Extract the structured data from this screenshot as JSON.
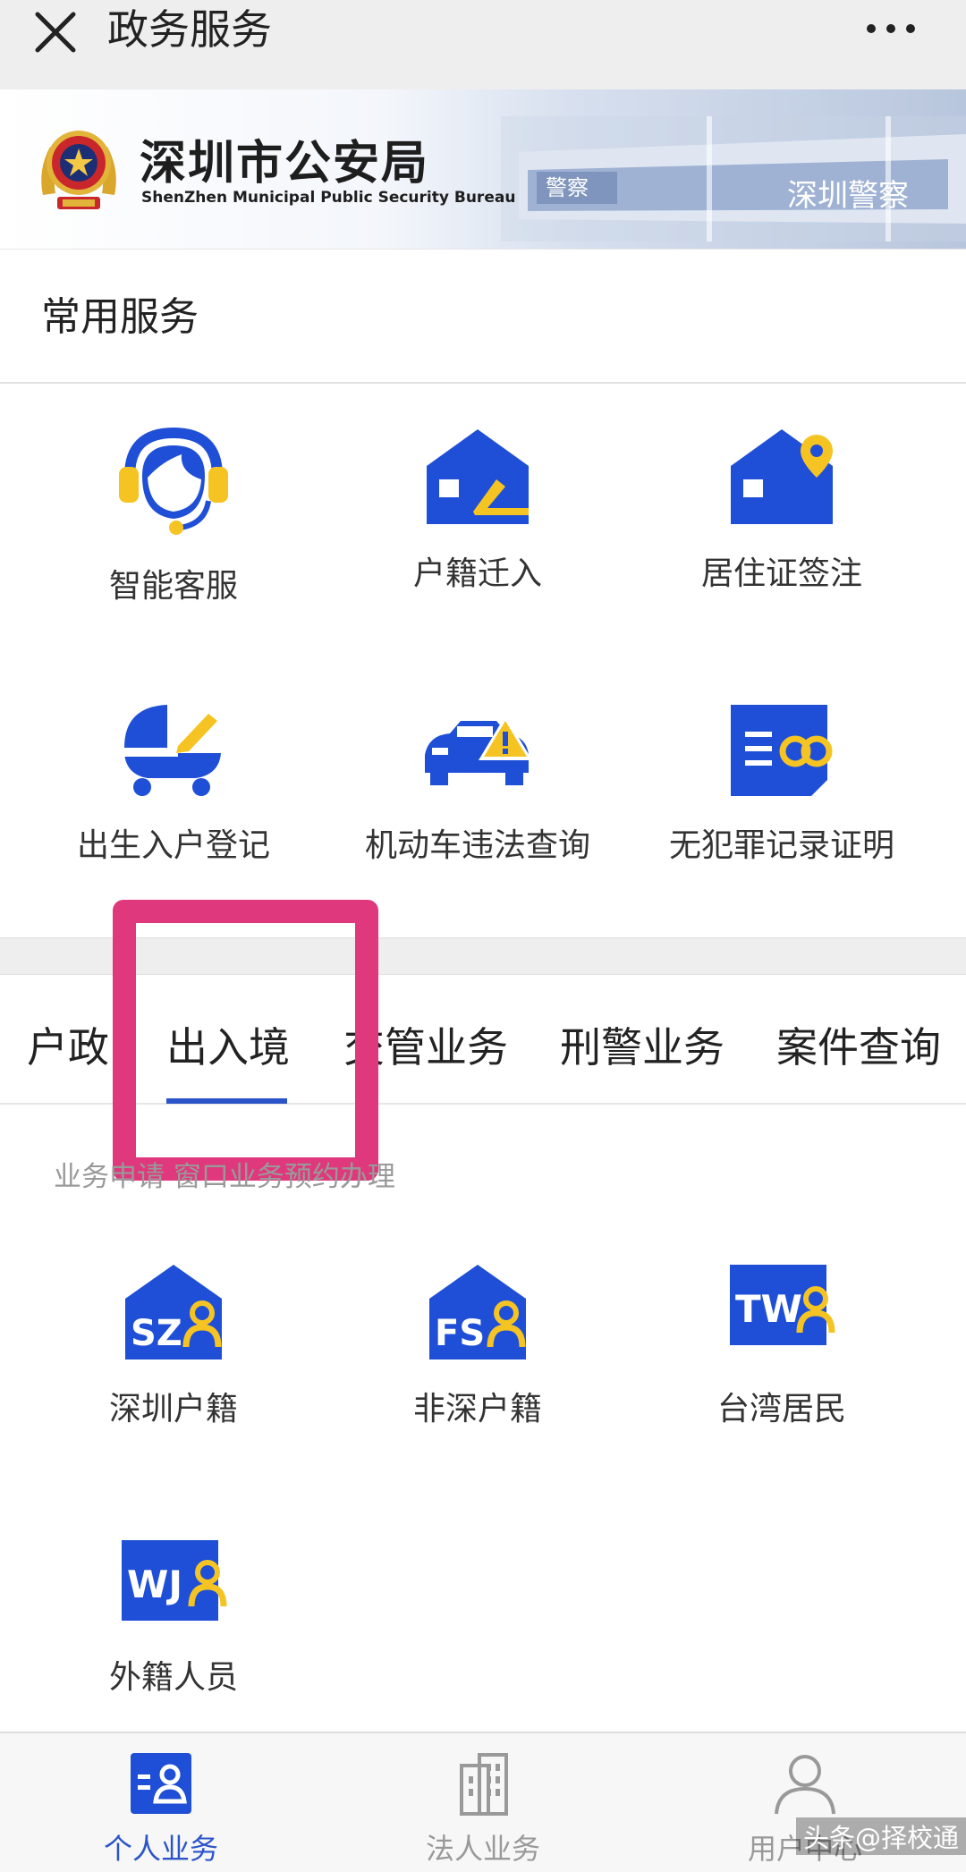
{
  "navbar": {
    "title": "政务服务"
  },
  "banner": {
    "title_cn": "深圳市公安局",
    "title_en": "ShenZhen Municipal Public Security Bureau",
    "wall_text_1": "警察",
    "wall_text_2": "深圳警察"
  },
  "common_services": {
    "title": "常用服务",
    "items": [
      {
        "label": "智能客服",
        "icon": "customer-service-headset-icon"
      },
      {
        "label": "户籍迁入",
        "icon": "house-move-in-icon"
      },
      {
        "label": "居住证签注",
        "icon": "house-location-pin-icon"
      },
      {
        "label": "出生入户登记",
        "icon": "baby-stroller-icon"
      },
      {
        "label": "机动车违法查询",
        "icon": "car-warning-icon"
      },
      {
        "label": "无犯罪记录证明",
        "icon": "document-handcuffs-icon"
      }
    ]
  },
  "tabs": {
    "items": [
      "户政",
      "出入境",
      "交管业务",
      "刑警业务",
      "案件查询"
    ],
    "active": "出入境",
    "sub_links": "业务申请 窗口业务预约办理"
  },
  "entry_exit_services": {
    "items": [
      {
        "label": "深圳户籍",
        "badge": "SZ",
        "icon": "sz-house-person-icon"
      },
      {
        "label": "非深户籍",
        "badge": "FS",
        "icon": "fs-house-person-icon"
      },
      {
        "label": "台湾居民",
        "badge": "TW",
        "icon": "tw-card-person-icon"
      },
      {
        "label": "外籍人员",
        "badge": "WJ",
        "icon": "wj-card-person-icon"
      }
    ]
  },
  "bottom_nav": {
    "items": [
      {
        "label": "个人业务",
        "active": true
      },
      {
        "label": "法人业务",
        "active": false
      },
      {
        "label": "用户中心",
        "active": false
      }
    ]
  },
  "watermark": "头条@择校通",
  "colors": {
    "blue": "#1f4fd6",
    "yellow": "#f5c423",
    "active_blue": "#2b54c9",
    "highlight_pink": "#e0387c",
    "inactive_grey": "#999999"
  }
}
